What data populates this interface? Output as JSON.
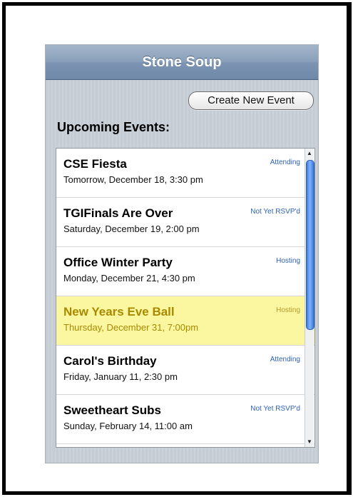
{
  "header": {
    "title": "Stone Soup"
  },
  "toolbar": {
    "create_label": "Create New Event"
  },
  "section": {
    "title": "Upcoming Events:"
  },
  "events": [
    {
      "title": "CSE Fiesta",
      "date": "Tomorrow, December 18, 3:30 pm",
      "status": "Attending",
      "highlighted": false
    },
    {
      "title": "TGIFinals Are Over",
      "date": "Saturday, December 19, 2:00 pm",
      "status": "Not Yet RSVP'd",
      "highlighted": false
    },
    {
      "title": "Office Winter Party",
      "date": "Monday, December 21, 4:30 pm",
      "status": "Hosting",
      "highlighted": false
    },
    {
      "title": "New Years Eve Ball",
      "date": "Thursday, December 31, 7:00pm",
      "status": "Hosting",
      "highlighted": true
    },
    {
      "title": "Carol's Birthday",
      "date": "Friday, January 11, 2:30 pm",
      "status": "Attending",
      "highlighted": false
    },
    {
      "title": "Sweetheart Subs",
      "date": "Sunday, February 14, 11:00 am",
      "status": "Not Yet RSVP'd",
      "highlighted": false
    }
  ],
  "icons": {
    "scroll_up": "up-arrow-icon",
    "scroll_down": "down-arrow-icon"
  },
  "colors": {
    "highlight": "#fbf6a0",
    "status": "#2f62b6",
    "navbar": "#8aa0bb"
  }
}
